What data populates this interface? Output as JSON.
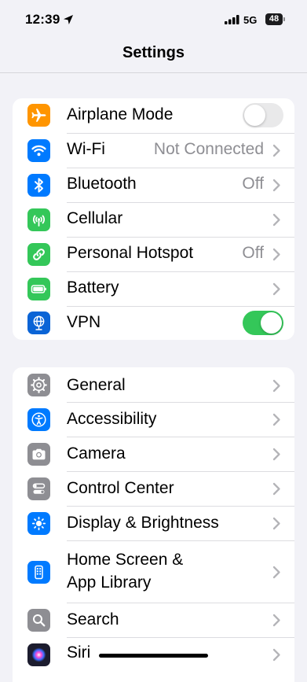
{
  "status_bar": {
    "time": "12:39",
    "network": "5G",
    "battery": "48",
    "icons": [
      "location-arrow-icon",
      "cellular-signal-icon",
      "battery-icon"
    ]
  },
  "nav": {
    "title": "Settings"
  },
  "groups": [
    {
      "rows": [
        {
          "label": "Airplane Mode",
          "icon": "airplane-icon",
          "color": "#ff9500",
          "toggle": "off"
        },
        {
          "label": "Wi-Fi",
          "icon": "wifi-icon",
          "color": "#007aff",
          "value": "Not Connected"
        },
        {
          "label": "Bluetooth",
          "icon": "bluetooth-icon",
          "color": "#007aff",
          "value": "Off"
        },
        {
          "label": "Cellular",
          "icon": "cellular-antenna-icon",
          "color": "#34c759"
        },
        {
          "label": "Personal Hotspot",
          "icon": "hotspot-link-icon",
          "color": "#34c759",
          "value": "Off"
        },
        {
          "label": "Battery",
          "icon": "battery-icon",
          "color": "#34c759"
        },
        {
          "label": "VPN",
          "icon": "vpn-globe-icon",
          "color": "#0a64d6",
          "toggle": "on"
        }
      ]
    },
    {
      "rows": [
        {
          "label": "General",
          "icon": "gear-icon",
          "color": "#8e8e93"
        },
        {
          "label": "Accessibility",
          "icon": "accessibility-icon",
          "color": "#007aff"
        },
        {
          "label": "Camera",
          "icon": "camera-icon",
          "color": "#8e8e93"
        },
        {
          "label": "Control Center",
          "icon": "control-center-icon",
          "color": "#8e8e93"
        },
        {
          "label": "Display & Brightness",
          "icon": "sun-icon",
          "color": "#007aff"
        },
        {
          "label": "Home Screen &",
          "label2": "App Library",
          "icon": "home-screen-icon",
          "color": "#007aff"
        },
        {
          "label": "Search",
          "icon": "search-icon",
          "color": "#8e8e93"
        },
        {
          "label": "Siri",
          "icon": "siri-icon",
          "color": "#1c1c2e"
        }
      ]
    }
  ],
  "colors": {
    "background": "#f2f2f7",
    "toggle_on": "#34c759",
    "secondary_text": "#8e8e93"
  }
}
